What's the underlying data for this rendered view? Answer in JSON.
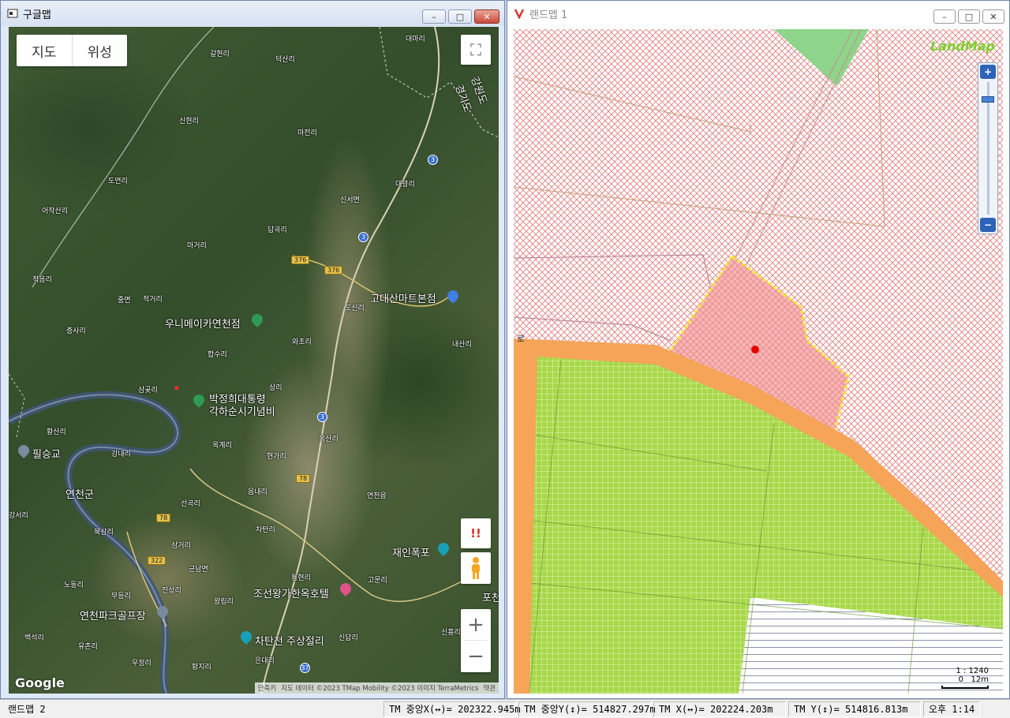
{
  "left_window": {
    "title": "구글맵",
    "controls": {
      "minimize": "–",
      "maximize": "□",
      "close": "✕"
    },
    "maptype": {
      "map": "지도",
      "satellite": "위성"
    },
    "labels": {
      "l1": "대마리",
      "l2": "갈현리",
      "l3": "덕산리",
      "l4": "신현리",
      "l5": "마전리",
      "l6": "도연리",
      "l7": "어작산리",
      "l8": "신서면",
      "l9": "대광리",
      "l10": "답곡리",
      "l11": "마거리",
      "l12": "적음리",
      "l13": "중면",
      "l14": "적거리",
      "l15": "도신리",
      "l16": "증사리",
      "l17": "와초리",
      "l18": "내산리",
      "l19": "합수리",
      "l20": "삼곶리",
      "l21": "상리",
      "l22": "황산리",
      "l23": "옥산리",
      "l24": "강내리",
      "l25": "옥계리",
      "l26": "현가리",
      "l27": "읍내리",
      "l28": "연천읍",
      "l29": "강서리",
      "l30": "선곡리",
      "l31": "북삼리",
      "l32": "차탄리",
      "l33": "삼거리",
      "l34": "군남면",
      "l35": "통현리",
      "l36": "고문리",
      "l37": "노동리",
      "l38": "진상리",
      "l39": "무등리",
      "l40": "왕림리",
      "l41": "백석리",
      "l42": "유촌리",
      "l43": "우정리",
      "l44": "황지리",
      "l45": "신답리",
      "l46": "은대리",
      "l47": "신흥리",
      "l48": "포천",
      "l49": "강원도",
      "l50": "경기도"
    },
    "big_labels": {
      "gogo": "고대산마트본점",
      "woni": "우니메이카연천점",
      "park": "박정희대통령",
      "park2": "각하순시기념비",
      "pilseung": "필승교",
      "yeoncheon": "연천군",
      "jaein": "재인폭포",
      "joseon": "조선왕가한옥호텔",
      "golf": "연천파크골프장",
      "chatan": "차탄천 주상절리"
    },
    "shields": {
      "r3": "3",
      "r376": "376",
      "r78": "78",
      "r322": "322",
      "r37": "37"
    },
    "google_logo": "Google",
    "attribution": {
      "shortcuts": "단축키",
      "data": "지도 데이터 ©2023 TMap Mobility ©2023 이미지 TerraMetrics",
      "terms": "약관"
    },
    "buttons": {
      "fullscreen": "⛶",
      "warning": "!!",
      "zoom_in": "+",
      "zoom_out": "−"
    }
  },
  "right_window": {
    "title": "랜드맵 1",
    "controls": {
      "minimize": "–",
      "maximize": "□",
      "close": "✕"
    },
    "logo": "LandMap",
    "zoom": {
      "plus": "+",
      "minus": "−"
    },
    "scale_ratio": "1 : 1240",
    "scale_left": "0",
    "scale_len": "12m",
    "edge_label": "로"
  },
  "status_bar": {
    "app": "랜드맵 2",
    "tm_center_x": "TM 중앙X(↔)= 202322.945m",
    "tm_center_y": "TM 중앙Y(↕)= 514827.297m",
    "tm_x": "TM X(↔)= 202224.203m",
    "tm_y": "TM Y(↕)= 514816.813m",
    "time": "오후 1:14"
  },
  "colors": {
    "accent": "#2e63b8",
    "parcel_red": "#f08a8a",
    "zone_green": "#a7d84a",
    "road_orange": "#f5a458",
    "boundary_yellow": "#ffe600"
  }
}
